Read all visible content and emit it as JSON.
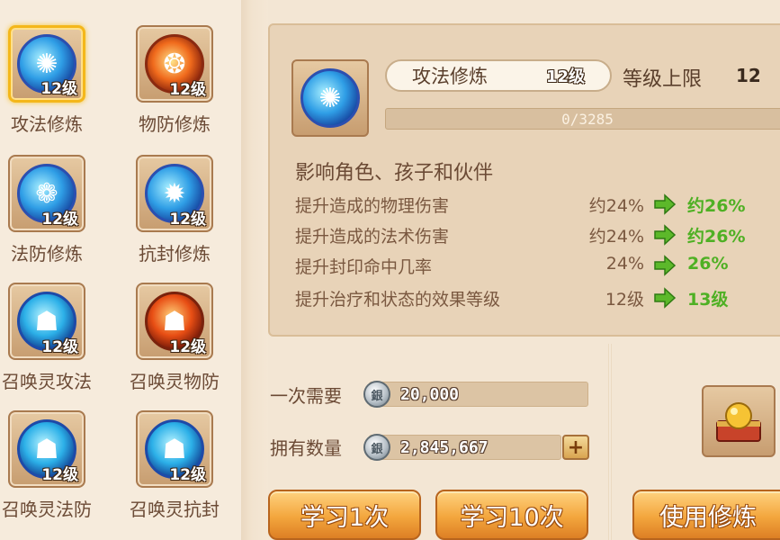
{
  "skills": [
    {
      "name": "攻法修炼",
      "level": "12级",
      "icon": "spell-attack-icon",
      "selected": true
    },
    {
      "name": "物防修炼",
      "level": "12级",
      "icon": "physical-defense-icon"
    },
    {
      "name": "法防修炼",
      "level": "12级",
      "icon": "spell-defense-icon"
    },
    {
      "name": "抗封修炼",
      "level": "12级",
      "icon": "seal-resist-icon"
    },
    {
      "name": "召唤灵攻法",
      "level": "12级",
      "icon": "summon-spell-attack-icon"
    },
    {
      "name": "召唤灵物防",
      "level": "12级",
      "icon": "summon-physical-defense-icon"
    },
    {
      "name": "召唤灵法防",
      "level": "12级",
      "icon": "summon-spell-defense-icon"
    },
    {
      "name": "召唤灵抗封",
      "level": "12级",
      "icon": "summon-seal-resist-icon"
    }
  ],
  "detail": {
    "name": "攻法修炼",
    "level": "12级",
    "cap_label": "等级上限",
    "cap_value": "12",
    "progress_text": "0/3285",
    "progress_fraction": 0,
    "affect": "影响角色、孩子和伙伴",
    "stats": [
      {
        "label": "提升造成的物理伤害",
        "current": "约24%",
        "next": "约26%"
      },
      {
        "label": "提升造成的法术伤害",
        "current": "约24%",
        "next": "约26%"
      },
      {
        "label": "提升封印命中几率",
        "current": "24%",
        "next": "26%"
      },
      {
        "label": "提升治疗和状态的效果等级",
        "current": "12级",
        "next": "13级"
      }
    ]
  },
  "cost": {
    "per_label": "一次需要",
    "per_value": "20,000",
    "own_label": "拥有数量",
    "own_value": "2,845,667"
  },
  "buttons": {
    "learn_once": "学习1次",
    "learn_ten": "学习10次",
    "use_item": "使用修炼"
  },
  "colors": {
    "accent_green": "#4fb024",
    "button_orange": "#f3a63d",
    "selected_gold": "#f4b71a"
  }
}
